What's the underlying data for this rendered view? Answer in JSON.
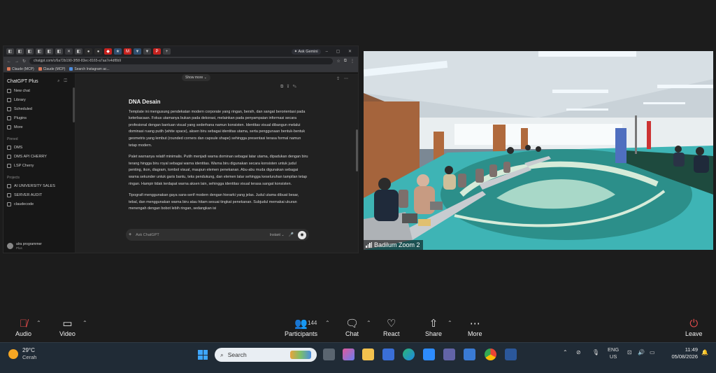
{
  "browser": {
    "gemini_label": "✦ Ask Gemini",
    "window_controls": "– ▢ ✕",
    "url": "chatgpt.com/c/6a72b190-3f58-83ec-8165-a7aa7e4df8b9",
    "bookmarks": [
      "Claude (MCP)",
      "Claude (MCP)",
      "Search Instagram ac..."
    ]
  },
  "chatgpt": {
    "brand": "ChatGPT Plus",
    "nav": [
      "New chat",
      "Library",
      "Scheduled",
      "Plugins",
      "More"
    ],
    "pinned_header": "Pinned",
    "pinned": [
      "DMS",
      "DMS API CHERRY",
      "LSP Cherry"
    ],
    "projects_header": "Projects",
    "projects": [
      "AI UNIVERSITY SALES",
      "SERVER AUDIT",
      "claudecode"
    ],
    "user_name": "alra programmer",
    "user_plan": "Plus",
    "show_more": "Show more ⌄",
    "article": {
      "heading": "DNA Desain",
      "paragraphs": [
        "Template ini mengusung pendekatan modern corporate yang ringan, bersih, dan sangat berorientasi pada keterbacaan. Fokus utamanya bukan pada dekorasi, melainkan pada penyampaian informasi secara profesional dengan bantuan visual yang sederhana namun konsisten. Identitas visual dibangun melalui dominasi ruang putih (white space), aksen biru sebagai identitas utama, serta penggunaan bentuk-bentuk geometris yang lembut (rounded corners dan capsule shape) sehingga presentasi terasa formal namun tetap modern.",
        "Palet warnanya relatif minimalis. Putih menjadi warna dominan sebagai latar utama, dipadukan dengan biru terang hingga biru royal sebagai warna identitas. Warna biru digunakan secara konsisten untuk judul penting, ikon, diagram, tombol visual, maupun elemen penekanan. Abu-abu muda digunakan sebagai warna sekunder untuk garis bantu, teks pendukung, dan elemen latar sehingga keseluruhan tampilan tetap ringan. Hampir tidak terdapat warna aksen lain, sehingga identitas visual terasa sangat konsisten.",
        "Tipografi menggunakan gaya sans-serif modern dengan hierarki yang jelas. Judul utama dibuat besar, tebal, dan menggunakan warna biru atau hitam sesuai tingkat penekanan. Subjudul memakai ukuran menengah dengan bobot lebih ringan, sedangkan isi"
      ]
    },
    "composer_placeholder": "Ask ChatGPT",
    "composer_mode": "Instant ⌄"
  },
  "video": {
    "participant_name": "Badilum Zoom 2"
  },
  "zoom_toolbar": {
    "audio": "Audio",
    "video": "Video",
    "participants": "Participants",
    "participant_count": "144",
    "chat": "Chat",
    "react": "React",
    "share": "Share",
    "more": "More",
    "leave": "Leave"
  },
  "taskbar": {
    "temperature": "29°C",
    "condition": "Cerah",
    "search_placeholder": "Search",
    "lang_line1": "ENG",
    "lang_line2": "US",
    "time": "11:49",
    "date": "05/08/2026"
  },
  "colors": {
    "zoom_leave": "#e24b4b",
    "windows_accent": "#3ea6ff",
    "chatgpt_bg": "#212121"
  }
}
